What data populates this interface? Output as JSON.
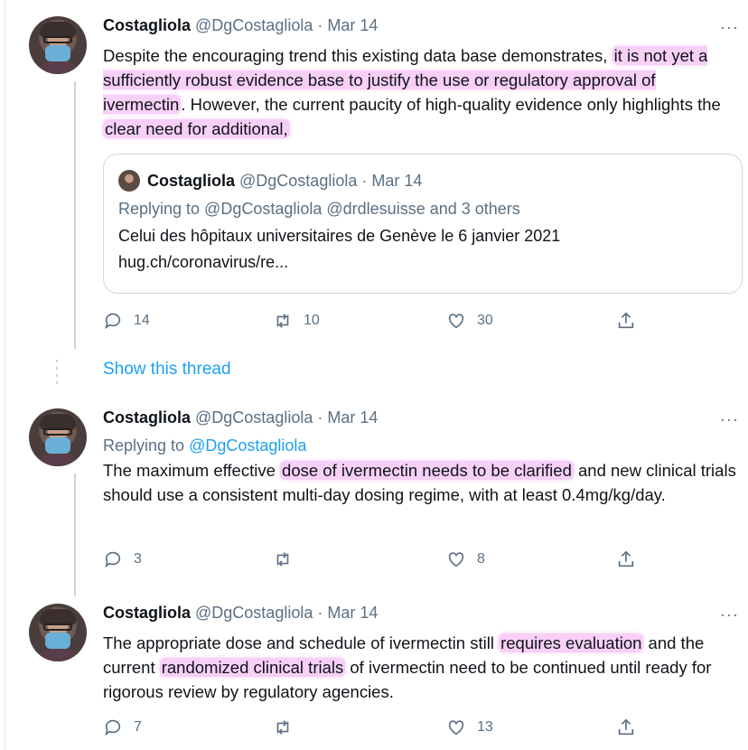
{
  "tweets": [
    {
      "name": "Costagliola",
      "handle": "@DgCostagliola",
      "separator": "·",
      "date": "Mar 14",
      "more": "···",
      "text_parts": [
        "Despite the encouraging trend this existing data base demonstrates, ",
        "it is not yet a sufficiently robust evidence base to justify the use or regulatory approval of ivermectin",
        ". However, the current paucity of high-quality evidence only highlights the ",
        "clear need for additional,"
      ],
      "quote": {
        "name": "Costagliola",
        "handle": "@DgCostagliola",
        "separator": "·",
        "date": "Mar 14",
        "reply_line": "Replying to @DgCostagliola @drdlesuisse and 3 others",
        "text_line1": "Celui des hôpitaux universitaires de Genève le 6 janvier 2021",
        "text_line2": "hug.ch/coronavirus/re..."
      },
      "actions": {
        "replies": "14",
        "retweets": "10",
        "likes": "30"
      }
    },
    {
      "name": "Costagliola",
      "handle": "@DgCostagliola",
      "separator": "·",
      "date": "Mar 14",
      "more": "···",
      "replying_prefix": "Replying to ",
      "replying_link": "@DgCostagliola",
      "text_parts": [
        "The maximum effective ",
        "dose of ivermectin needs to be clarified",
        " and new clinical trials should use a consistent multi-day dosing regime, with at least 0.4mg/kg/day."
      ],
      "actions": {
        "replies": "3",
        "retweets": "",
        "likes": "8"
      }
    },
    {
      "name": "Costagliola",
      "handle": "@DgCostagliola",
      "separator": "·",
      "date": "Mar 14",
      "more": "···",
      "text_parts": [
        "The appropriate dose and schedule of ivermectin still ",
        "requires evaluation",
        " and the current ",
        "randomized clinical trials",
        " of ivermectin need to be continued until ready for rigorous review by regulatory agencies."
      ],
      "actions": {
        "replies": "7",
        "retweets": "",
        "likes": "13"
      }
    }
  ],
  "show_thread": "Show this thread",
  "colors": {
    "link": "#1da1f2",
    "muted": "#5b7083",
    "highlight": "#eb8ceb",
    "text": "#0f1419"
  },
  "icons": [
    "reply-icon",
    "retweet-icon",
    "like-icon",
    "share-icon",
    "more-icon"
  ]
}
